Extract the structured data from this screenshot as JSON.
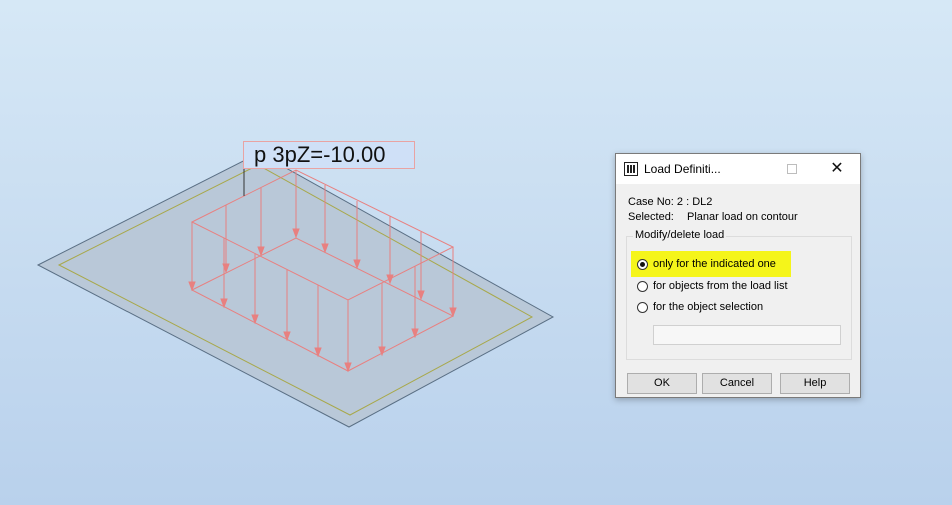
{
  "viewport": {
    "load_label": "p 3pZ=-10.00",
    "colors": {
      "plate_fill": "#b9c8d8",
      "plate_edge": "#5a6f84",
      "contour": "#a8a84a",
      "load": "#e88080"
    }
  },
  "dialog": {
    "title": "Load Definiti...",
    "case_label": "Case No: 2 : DL2",
    "selected_label": "Selected:",
    "selected_value": "Planar load on contour",
    "group_title": "Modify/delete load",
    "options": [
      {
        "label": "only for the indicated one",
        "checked": true
      },
      {
        "label": "for objects from the load list",
        "checked": false
      },
      {
        "label": "for the object selection",
        "checked": false
      }
    ],
    "selection_field_value": "",
    "buttons": {
      "ok": "OK",
      "cancel": "Cancel",
      "help": "Help"
    },
    "highlight_color": "#f5f51a",
    "icons": [
      "app-icon",
      "maximize-icon",
      "close-icon"
    ]
  }
}
